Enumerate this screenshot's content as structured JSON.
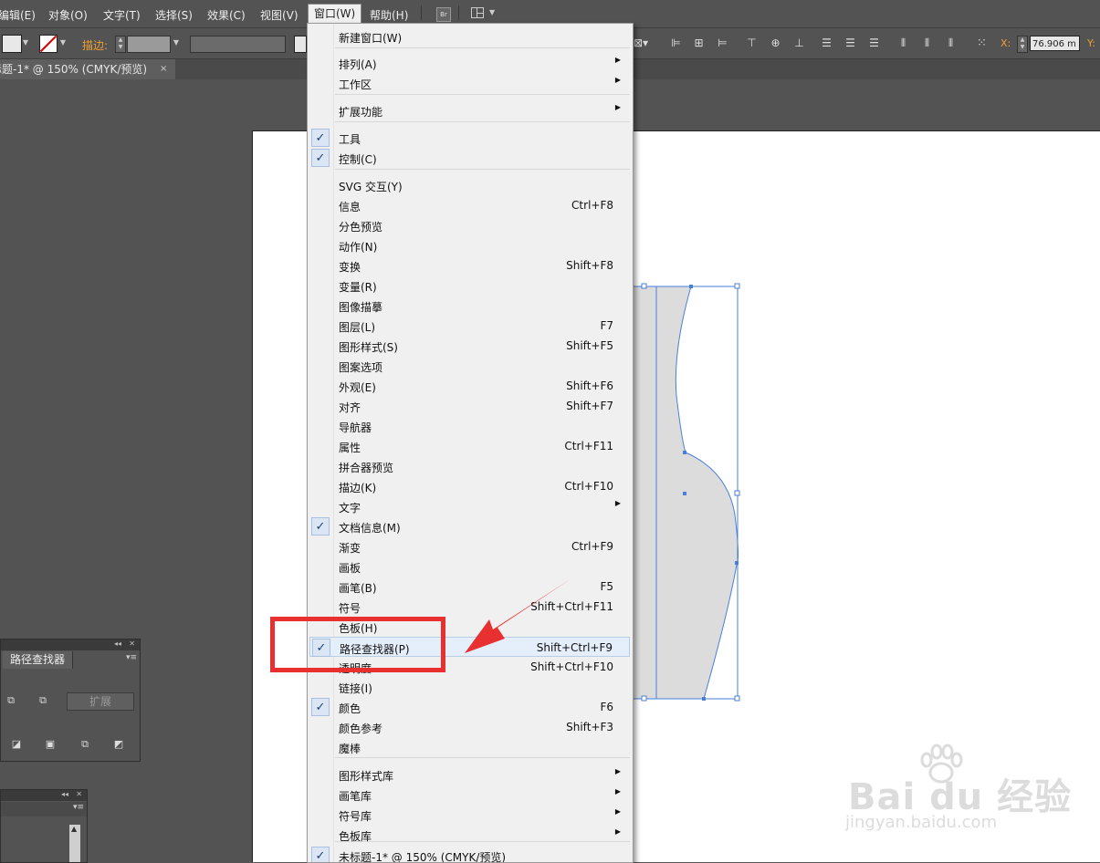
{
  "menubar": {
    "items": [
      "编辑(E)",
      "对象(O)",
      "文字(T)",
      "选择(S)",
      "效果(C)",
      "视图(V)",
      "窗口(W)",
      "帮助(H)"
    ],
    "bridge_label": "Br"
  },
  "controlbar": {
    "stroke_label": "描边:",
    "x_label": "X:",
    "x_value": "76.906 m",
    "y_label": "Y:"
  },
  "document": {
    "tab_title": "标题-1* @ 150% (CMYK/预览)",
    "close_glyph": "×"
  },
  "pathfinder_panel": {
    "tab_label": "路径查找器",
    "expand_label": "扩展"
  },
  "window_menu": {
    "items": [
      {
        "label": "新建窗口(W)",
        "shortcut": "",
        "submenu": false,
        "checked": false
      },
      {
        "label": "排列(A)",
        "shortcut": "",
        "submenu": true,
        "checked": false
      },
      {
        "label": "工作区",
        "shortcut": "",
        "submenu": true,
        "checked": false
      },
      {
        "label": "扩展功能",
        "shortcut": "",
        "submenu": true,
        "checked": false
      },
      {
        "label": "工具",
        "shortcut": "",
        "submenu": false,
        "checked": true
      },
      {
        "label": "控制(C)",
        "shortcut": "",
        "submenu": false,
        "checked": true
      },
      {
        "label": "SVG 交互(Y)",
        "shortcut": "",
        "submenu": false,
        "checked": false
      },
      {
        "label": "信息",
        "shortcut": "Ctrl+F8",
        "submenu": false,
        "checked": false
      },
      {
        "label": "分色预览",
        "shortcut": "",
        "submenu": false,
        "checked": false
      },
      {
        "label": "动作(N)",
        "shortcut": "",
        "submenu": false,
        "checked": false
      },
      {
        "label": "变换",
        "shortcut": "Shift+F8",
        "submenu": false,
        "checked": false
      },
      {
        "label": "变量(R)",
        "shortcut": "",
        "submenu": false,
        "checked": false
      },
      {
        "label": "图像描摹",
        "shortcut": "",
        "submenu": false,
        "checked": false
      },
      {
        "label": "图层(L)",
        "shortcut": "F7",
        "submenu": false,
        "checked": false
      },
      {
        "label": "图形样式(S)",
        "shortcut": "Shift+F5",
        "submenu": false,
        "checked": false
      },
      {
        "label": "图案选项",
        "shortcut": "",
        "submenu": false,
        "checked": false
      },
      {
        "label": "外观(E)",
        "shortcut": "Shift+F6",
        "submenu": false,
        "checked": false
      },
      {
        "label": "对齐",
        "shortcut": "Shift+F7",
        "submenu": false,
        "checked": false
      },
      {
        "label": "导航器",
        "shortcut": "",
        "submenu": false,
        "checked": false
      },
      {
        "label": "属性",
        "shortcut": "Ctrl+F11",
        "submenu": false,
        "checked": false
      },
      {
        "label": "拼合器预览",
        "shortcut": "",
        "submenu": false,
        "checked": false
      },
      {
        "label": "描边(K)",
        "shortcut": "Ctrl+F10",
        "submenu": false,
        "checked": false
      },
      {
        "label": "文字",
        "shortcut": "",
        "submenu": true,
        "checked": false
      },
      {
        "label": "文档信息(M)",
        "shortcut": "",
        "submenu": false,
        "checked": true
      },
      {
        "label": "渐变",
        "shortcut": "Ctrl+F9",
        "submenu": false,
        "checked": false
      },
      {
        "label": "画板",
        "shortcut": "",
        "submenu": false,
        "checked": false
      },
      {
        "label": "画笔(B)",
        "shortcut": "F5",
        "submenu": false,
        "checked": false
      },
      {
        "label": "符号",
        "shortcut": "Shift+Ctrl+F11",
        "submenu": false,
        "checked": false
      },
      {
        "label": "色板(H)",
        "shortcut": "",
        "submenu": false,
        "checked": false
      },
      {
        "label": "路径查找器(P)",
        "shortcut": "Shift+Ctrl+F9",
        "submenu": false,
        "checked": true,
        "highlighted": true
      },
      {
        "label": "透明度",
        "shortcut": "Shift+Ctrl+F10",
        "submenu": false,
        "checked": false
      },
      {
        "label": "链接(I)",
        "shortcut": "",
        "submenu": false,
        "checked": false
      },
      {
        "label": "颜色",
        "shortcut": "F6",
        "submenu": false,
        "checked": true
      },
      {
        "label": "颜色参考",
        "shortcut": "Shift+F3",
        "submenu": false,
        "checked": false
      },
      {
        "label": "魔棒",
        "shortcut": "",
        "submenu": false,
        "checked": false
      },
      {
        "label": "图形样式库",
        "shortcut": "",
        "submenu": true,
        "checked": false
      },
      {
        "label": "画笔库",
        "shortcut": "",
        "submenu": true,
        "checked": false
      },
      {
        "label": "符号库",
        "shortcut": "",
        "submenu": true,
        "checked": false
      },
      {
        "label": "色板库",
        "shortcut": "",
        "submenu": true,
        "checked": false
      },
      {
        "label": "未标题-1* @ 150% (CMYK/预览)",
        "shortcut": "",
        "submenu": false,
        "checked": true
      }
    ],
    "check_glyph": "✓",
    "submenu_glyph": "▶"
  },
  "watermark": {
    "brand": "Bai du 经验",
    "url": "jingyan.baidu.com"
  },
  "colors": {
    "ui_background": "#535353",
    "menu_background": "#f0f0f0",
    "highlight": "#e5eefb",
    "annotation_red": "#e83030",
    "selection_blue": "#4a7fd8",
    "stroke_orange": "#f0a030"
  }
}
